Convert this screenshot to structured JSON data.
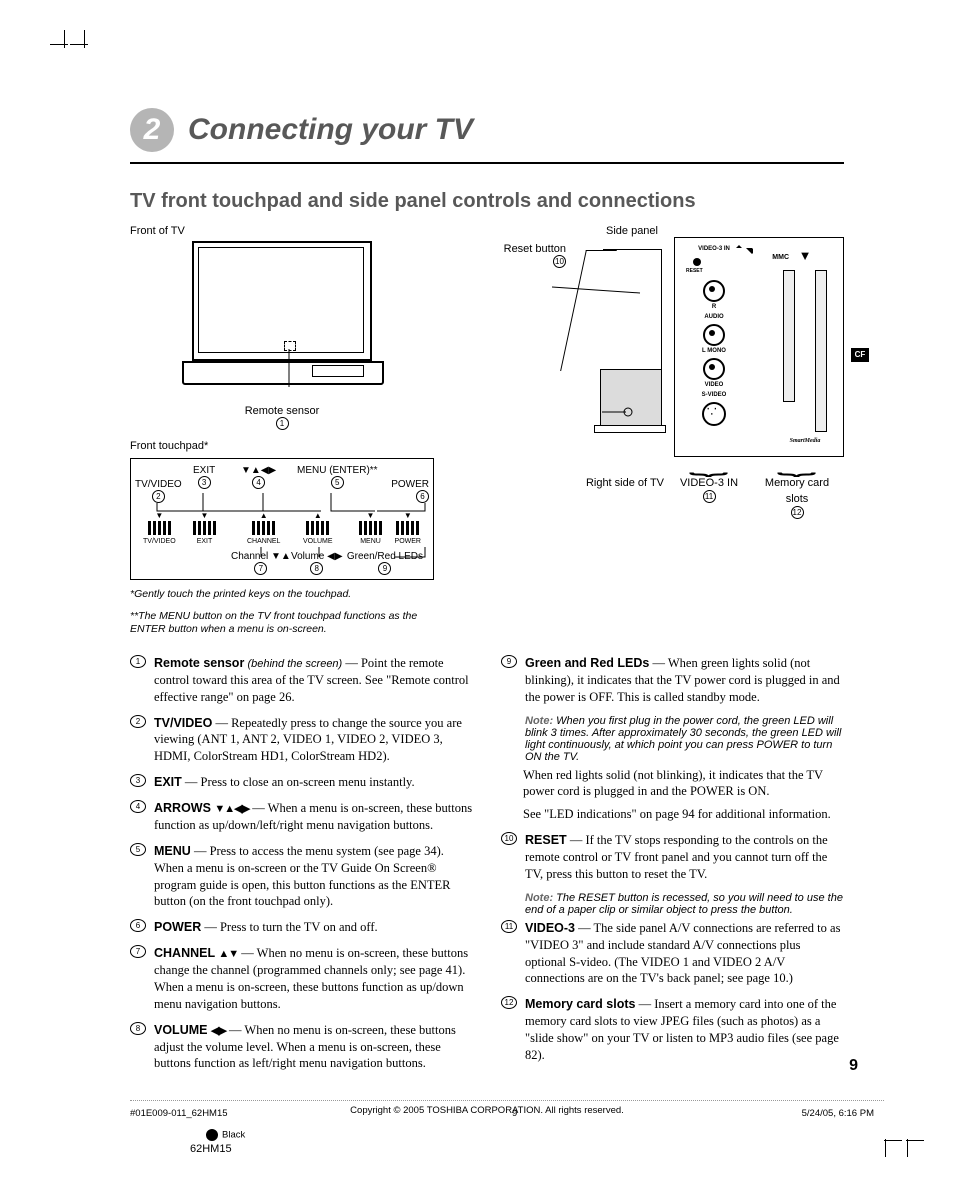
{
  "chapter": {
    "number": "2",
    "title": "Connecting your TV"
  },
  "section": "TV front touchpad and side panel controls and connections",
  "fig": {
    "frontLabel": "Front of TV",
    "remoteSensor": "Remote sensor",
    "remoteSensorNum": "1",
    "touchpadLabel": "Front touchpad*",
    "top": {
      "tvvideo": "TV/VIDEO",
      "tvvideoNum": "2",
      "exit": "EXIT",
      "exitNum": "3",
      "arrows": "▼▲◀▶",
      "arrowsNum": "4",
      "menu": "MENU (ENTER)**",
      "menuNum": "5",
      "power": "POWER",
      "powerNum": "6"
    },
    "bottom": {
      "tvvideo": "TV/VIDEO",
      "exit": "EXIT",
      "channel": "CHANNEL",
      "volume": "VOLUME",
      "menu": "MENU",
      "power": "POWER",
      "chLabel": "Channel ▼▲",
      "chNum": "7",
      "volLabel": "Volume ◀▶",
      "volNum": "8",
      "ledLabel": "Green/Red LEDs",
      "ledNum": "9"
    },
    "footnote1": "*Gently touch the printed keys on the touchpad.",
    "footnote2": "**The MENU button on the TV front touchpad functions as the ENTER button when a menu is on-screen.",
    "sidePanelLabel": "Side panel",
    "resetLabel": "Reset button",
    "resetNum": "10",
    "resetBtn": "RESET",
    "rightSide": "Right side of TV",
    "video3Label": "VIDEO-3 IN",
    "video3Num": "11",
    "cardSlotsLabel": "Memory card slots",
    "cardSlotsNum": "12",
    "mmc": "MMC",
    "video3in": "VIDEO-3 IN",
    "r": "R",
    "audio": "AUDIO",
    "l": "L",
    "mono": "MONO",
    "video": "VIDEO",
    "svideo": "S-VIDEO",
    "smartmedia": "SmartMedia",
    "cf": "CF"
  },
  "items": [
    {
      "n": "1",
      "b": "Remote sensor",
      "i": "(behind the screen)",
      "t": " — Point the remote control toward this area of the TV screen. See \"Remote control effective range\" on page 26."
    },
    {
      "n": "2",
      "b": "TV/VIDEO",
      "t": " — Repeatedly press to change the source you are viewing (ANT 1, ANT 2, VIDEO 1, VIDEO 2, VIDEO 3, HDMI, ColorStream HD1, ColorStream HD2)."
    },
    {
      "n": "3",
      "b": "EXIT",
      "t": " — Press to close an on-screen menu instantly."
    },
    {
      "n": "4",
      "b": "ARROWS ",
      "arrows": "▼▲◀▶",
      "t": " — When a menu is on-screen, these buttons function as up/down/left/right menu navigation buttons."
    },
    {
      "n": "5",
      "b": "MENU",
      "t": " — Press to access the menu system (see page 34). When a menu is on-screen or the TV Guide On Screen® program guide is open, this button functions as the ENTER button (on the front touchpad only)."
    },
    {
      "n": "6",
      "b": "POWER",
      "t": " — Press to turn the TV on and off."
    },
    {
      "n": "7",
      "b": "CHANNEL ",
      "arrows": "▲▼",
      "t": " — When no menu is on-screen, these buttons change the channel (programmed channels only; see page 41). When a menu is on-screen, these buttons function as up/down menu navigation buttons."
    },
    {
      "n": "8",
      "b": "VOLUME ",
      "arrows": "◀▶",
      "t": " — When no menu is on-screen, these buttons adjust the volume level. When a menu is on-screen, these buttons function as left/right menu navigation buttons."
    }
  ],
  "items2": [
    {
      "n": "9",
      "b": "Green and Red LEDs",
      "t": " — When green lights solid (not blinking), it indicates that the TV power cord is plugged in and the power is OFF. This is called standby mode.",
      "note": "When you first plug in the power cord, the green LED will blink 3 times. After approximately 30 seconds, the green LED will light continuously, at which point you can press POWER to turn ON the TV.",
      "after1": "When red lights solid (not blinking), it indicates that the TV power cord is plugged in and the POWER is ON.",
      "after2": "See \"LED indications\" on page 94 for additional information."
    },
    {
      "n": "10",
      "b": "RESET",
      "t": " — If the TV stops responding to the controls on the remote control or TV front panel and you cannot turn off the TV, press this button to reset the TV.",
      "note": "The RESET button is recessed, so you will need to use the end of a paper clip or similar object to press the button."
    },
    {
      "n": "11",
      "b": "VIDEO-3",
      "t": " — The side panel A/V connections are referred to as \"VIDEO 3\" and include standard A/V connections plus optional S-video. (The VIDEO 1 and VIDEO 2 A/V connections are on the TV's back panel; see page 10.)"
    },
    {
      "n": "12",
      "b": "Memory card slots",
      "t": " — Insert a memory card into one of the memory card slots to view JPEG files (such as photos) as a \"slide show\" on your TV or listen to MP3 audio files (see page 82)."
    }
  ],
  "noteLabel": "Note:",
  "copyright": "Copyright © 2005 TOSHIBA CORPORATION. All rights reserved.",
  "pageNumber": "9",
  "footer": {
    "doc": "#01E009-011_62HM15",
    "page": "9",
    "date": "5/24/05, 6:16 PM",
    "black": "Black",
    "model": "62HM15"
  }
}
